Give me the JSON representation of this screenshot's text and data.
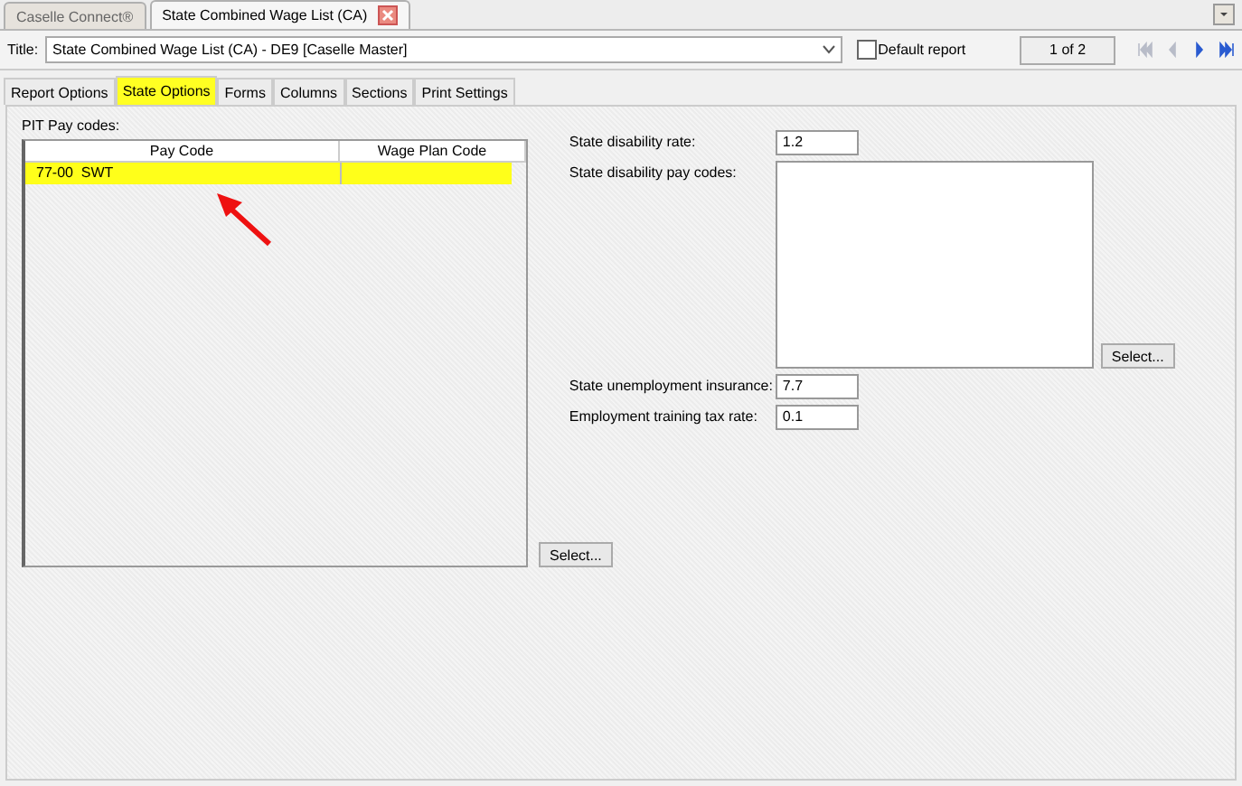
{
  "doc_tabs": [
    {
      "label": "Caselle Connect®",
      "selected": false,
      "closable": false
    },
    {
      "label": "State Combined Wage List (CA)",
      "selected": true,
      "closable": true
    }
  ],
  "title_row": {
    "label": "Title:",
    "value": "State Combined Wage List (CA) - DE9 [Caselle Master]",
    "default_report": {
      "label": "Default report",
      "checked": false
    },
    "page": "1 of 2",
    "nav_buttons": [
      {
        "kind": "first",
        "disabled": true
      },
      {
        "kind": "prev",
        "disabled": true
      },
      {
        "kind": "next",
        "disabled": false
      },
      {
        "kind": "last",
        "disabled": false
      }
    ]
  },
  "tabs": [
    {
      "label": "Report Options",
      "selected": false
    },
    {
      "label": "State Options",
      "selected": true
    },
    {
      "label": "Forms",
      "selected": false
    },
    {
      "label": "Columns",
      "selected": false
    },
    {
      "label": "Sections",
      "selected": false
    },
    {
      "label": "Print Settings",
      "selected": false
    }
  ],
  "pit_pay_codes": {
    "label": "PIT Pay codes:",
    "columns": [
      "Pay Code",
      "Wage Plan Code"
    ],
    "rows": [
      {
        "cells": [
          "77-00  SWT",
          ""
        ],
        "selected": true
      }
    ],
    "button": "Select..."
  },
  "fields": [
    {
      "kind": "text",
      "label": "State disability rate:",
      "value": "1.2"
    },
    {
      "kind": "list",
      "label": "State disability pay codes:",
      "button": "Select..."
    },
    {
      "kind": "text",
      "label": "State unemployment insurance:",
      "value": "7.7"
    },
    {
      "kind": "text",
      "label": "Employment training tax rate:",
      "value": "0.1"
    }
  ]
}
